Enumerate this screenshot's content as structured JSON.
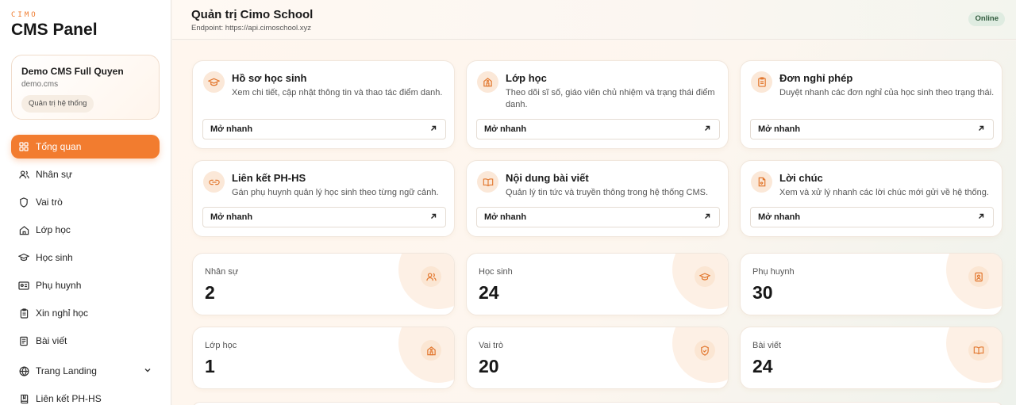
{
  "sidebar": {
    "brand_small": "CIMO",
    "brand_title": "CMS Panel",
    "user": {
      "name": "Demo CMS Full Quyen",
      "login": "demo.cms",
      "role": "Quản trị hệ thống"
    },
    "nav": [
      {
        "label": "Tổng quan",
        "icon": "grid-icon",
        "active": true
      },
      {
        "label": "Nhân sự",
        "icon": "users-icon"
      },
      {
        "label": "Vai trò",
        "icon": "shield-icon"
      },
      {
        "label": "Lớp học",
        "icon": "home-icon"
      },
      {
        "label": "Học sinh",
        "icon": "graduation-cap-icon"
      },
      {
        "label": "Phụ huynh",
        "icon": "id-card-icon"
      },
      {
        "label": "Xin nghỉ học",
        "icon": "clipboard-icon"
      },
      {
        "label": "Bài viết",
        "icon": "newspaper-icon"
      },
      {
        "label": "Trang Landing",
        "icon": "globe-icon",
        "expandable": true
      },
      {
        "label": "Liên kết PH-HS",
        "icon": "book-icon"
      }
    ]
  },
  "header": {
    "title": "Quản trị Cimo School",
    "endpoint": "Endpoint: https://api.cimoschool.xyz",
    "status": "Online"
  },
  "modules": [
    {
      "title": "Hồ sơ học sinh",
      "desc": "Xem chi tiết, cập nhật thông tin và thao tác điểm danh.",
      "action": "Mở nhanh",
      "icon": "graduation-cap-icon"
    },
    {
      "title": "Lớp học",
      "desc": "Theo dõi sĩ số, giáo viên chủ nhiệm và trạng thái điểm danh.",
      "action": "Mở nhanh",
      "icon": "school-icon"
    },
    {
      "title": "Đơn nghỉ phép",
      "desc": "Duyệt nhanh các đơn nghỉ của học sinh theo trạng thái.",
      "action": "Mở nhanh",
      "icon": "clipboard-icon"
    },
    {
      "title": "Liên kết PH-HS",
      "desc": "Gán phụ huynh quản lý học sinh theo từng ngữ cảnh.",
      "action": "Mở nhanh",
      "icon": "link-icon"
    },
    {
      "title": "Nội dung bài viết",
      "desc": "Quản lý tin tức và truyền thông trong hệ thống CMS.",
      "action": "Mở nhanh",
      "icon": "book-open-icon"
    },
    {
      "title": "Lời chúc",
      "desc": "Xem và xử lý nhanh các lời chúc mới gửi về hệ thống.",
      "action": "Mở nhanh",
      "icon": "message-icon"
    }
  ],
  "stats": [
    {
      "label": "Nhân sự",
      "value": "2",
      "icon": "users-icon"
    },
    {
      "label": "Học sinh",
      "value": "24",
      "icon": "graduation-cap-icon"
    },
    {
      "label": "Phụ huynh",
      "value": "30",
      "icon": "id-card-icon"
    },
    {
      "label": "Lớp học",
      "value": "1",
      "icon": "school-icon"
    },
    {
      "label": "Vai trò",
      "value": "20",
      "icon": "shield-icon"
    },
    {
      "label": "Bài viết",
      "value": "24",
      "icon": "book-open-icon"
    }
  ],
  "colors": {
    "accent": "#f27c2f",
    "status_bg": "#dfece1",
    "icon_bg": "#fbe8d8"
  }
}
